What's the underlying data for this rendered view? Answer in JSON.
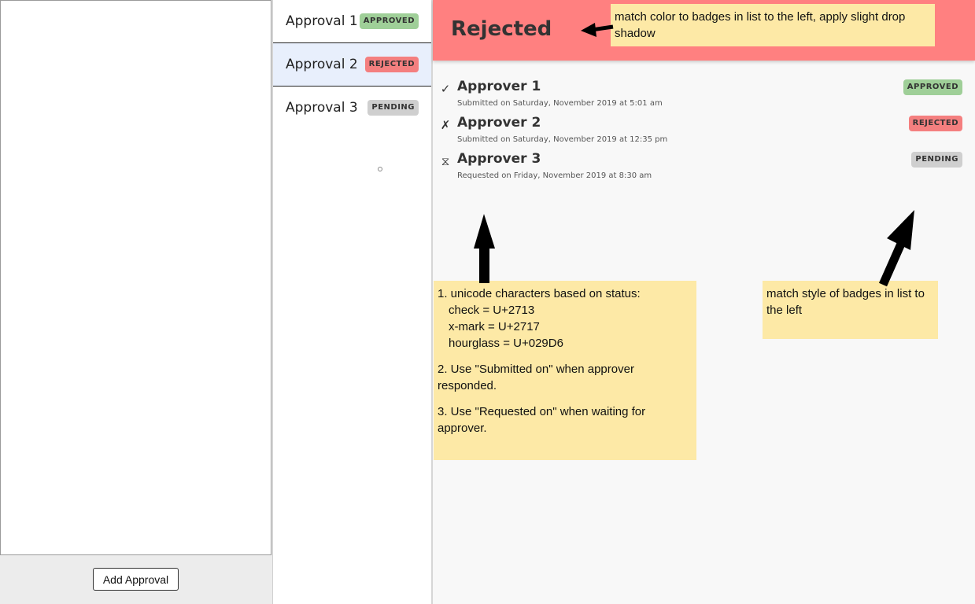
{
  "left": {
    "add_button": "Add Approval"
  },
  "approvals": [
    {
      "label": "Approval 1",
      "badge": "APPROVED",
      "selected": false
    },
    {
      "label": "Approval 2",
      "badge": "REJECTED",
      "selected": true
    },
    {
      "label": "Approval 3",
      "badge": "PENDING",
      "selected": false
    }
  ],
  "detail": {
    "status_title": "Rejected",
    "approvers": [
      {
        "icon": "✓",
        "icon_name": "check-icon",
        "name": "Approver 1",
        "meta": "Submitted on Saturday, November 2019 at 5:01 am",
        "badge": "APPROVED"
      },
      {
        "icon": "✗",
        "icon_name": "x-mark-icon",
        "name": "Approver 2",
        "meta": "Submitted on Saturday, November 2019 at 12:35 pm",
        "badge": "REJECTED"
      },
      {
        "icon": "⧖",
        "icon_name": "hourglass-icon",
        "name": "Approver 3",
        "meta": "Requested on Friday, November 2019 at 8:30 am",
        "badge": "PENDING"
      }
    ]
  },
  "annotations": {
    "header_note": "match color to badges in list to the left, apply slight drop shadow",
    "unicode_note": {
      "line1": "1. unicode characters based on status:",
      "line2": "check = U+2713",
      "line3": "x-mark = U+2717",
      "line4": "hourglass = U+029D6",
      "item2": "2. Use \"Submitted on\" when approver responded.",
      "item3": "3. Use \"Requested on\" when waiting for approver."
    },
    "badge_note": "match style of badges in list to the left"
  },
  "colors": {
    "approved": "#9fcf98",
    "rejected": "#f47f7f",
    "pending": "#cfcfcf",
    "header": "#ff8080",
    "selected_row": "#e8effc"
  }
}
